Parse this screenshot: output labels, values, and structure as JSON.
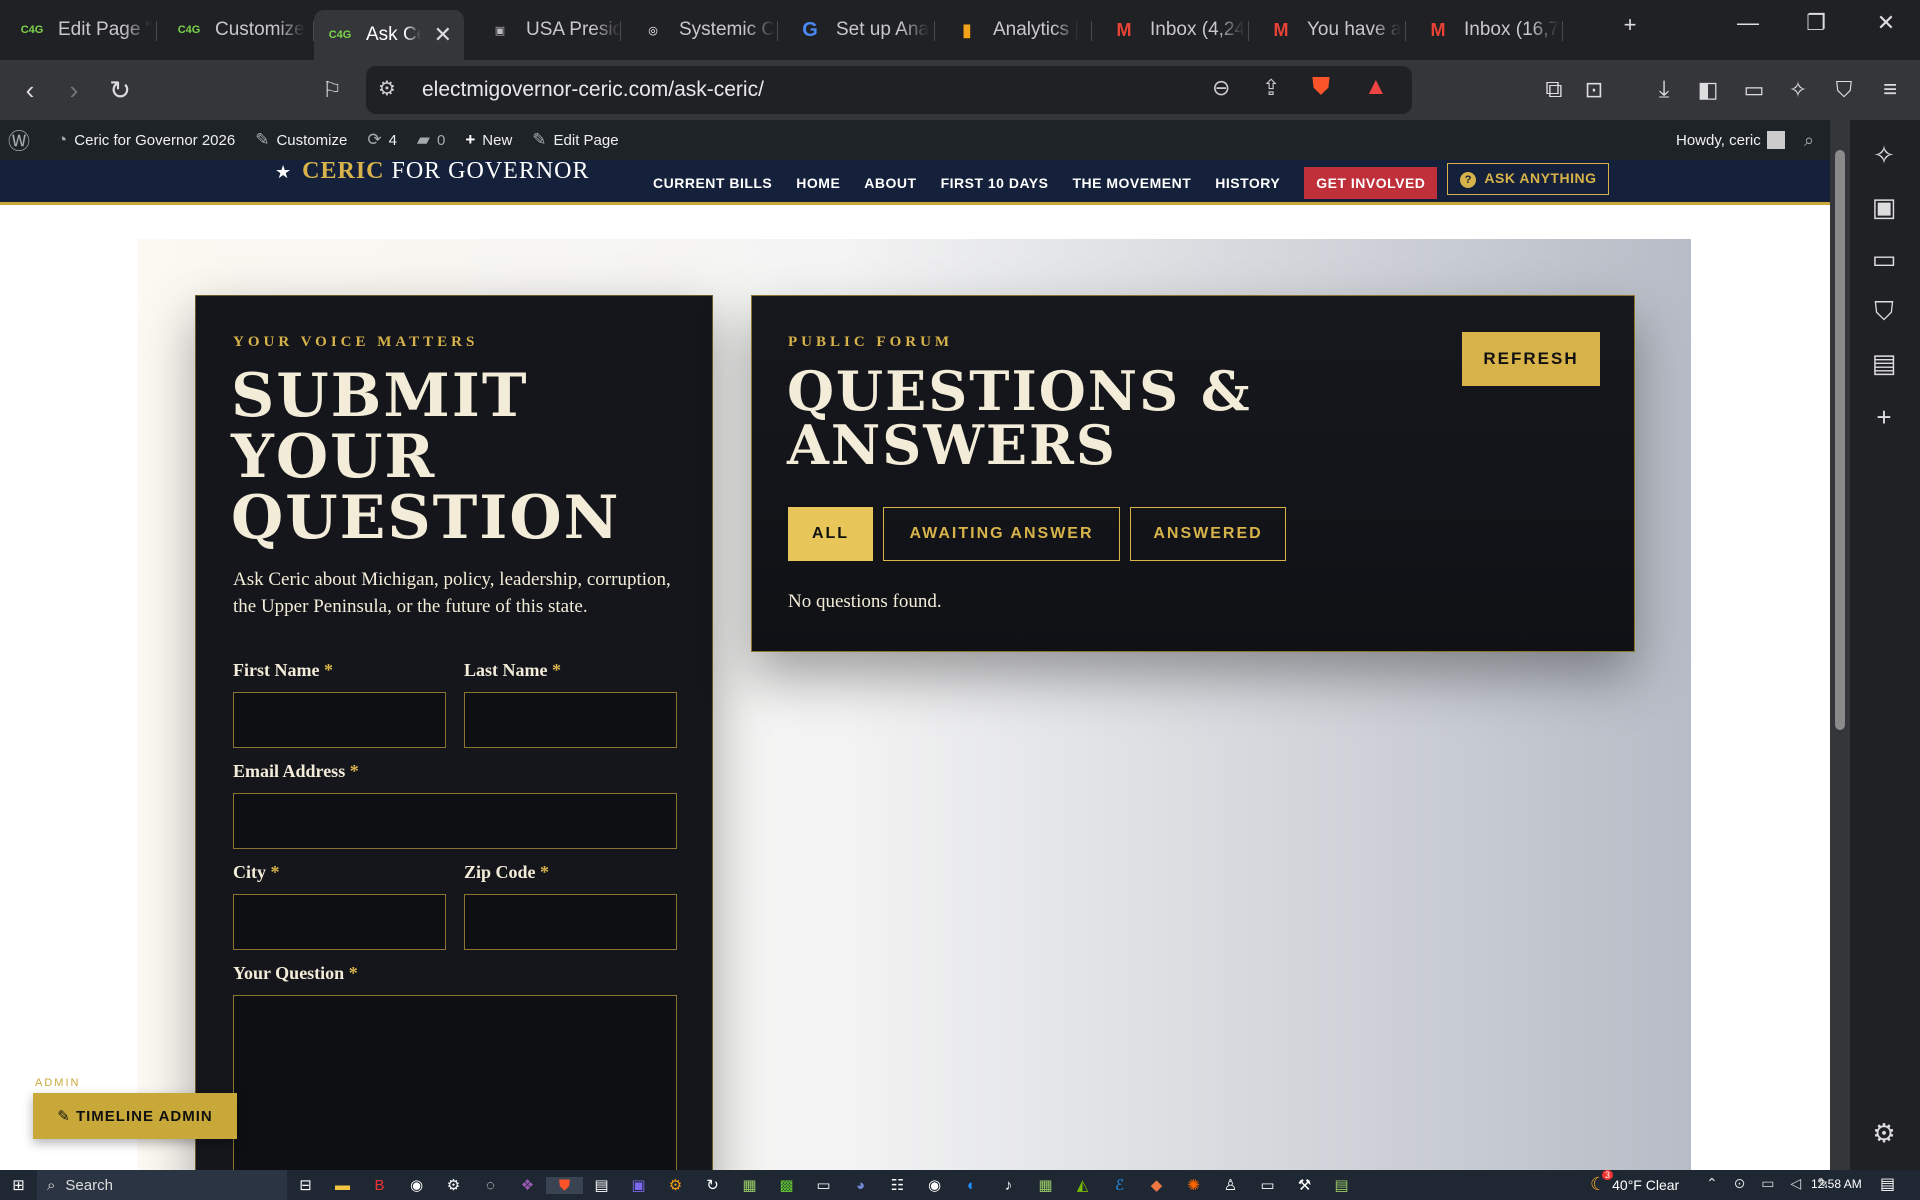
{
  "tabs": [
    {
      "title": "Edit Page \"",
      "icon": "C4G"
    },
    {
      "title": "Customize",
      "icon": "C4G"
    },
    {
      "title": "Ask Ce",
      "icon": "C4G",
      "active": true
    },
    {
      "title": "USA Presid",
      "icon": "▣"
    },
    {
      "title": "Systemic C",
      "icon": "◎"
    },
    {
      "title": "Set up Ana",
      "icon": "G"
    },
    {
      "title": "Analytics |",
      "icon": "▮"
    },
    {
      "title": "Inbox (4,24",
      "icon": "M"
    },
    {
      "title": "You have a",
      "icon": "M"
    },
    {
      "title": "Inbox (16,7",
      "icon": "M"
    }
  ],
  "address": {
    "url": "electmigovernor-ceric.com/ask-ceric/"
  },
  "wp": {
    "site": "Ceric for Governor 2026",
    "customize": "Customize",
    "updates": "4",
    "comments": "0",
    "new": "New",
    "edit": "Edit Page",
    "howdy": "Howdy, ceric"
  },
  "site": {
    "logo_bold": "CERIC",
    "logo_rest": " FOR GOVERNOR",
    "star": "★",
    "nav": [
      "CURRENT BILLS",
      "HOME",
      "ABOUT",
      "FIRST 10 DAYS",
      "THE MOVEMENT",
      "HISTORY"
    ],
    "get_involved": "GET INVOLVED",
    "ask_anything": "ASK ANYTHING"
  },
  "form": {
    "kicker": "YOUR VOICE MATTERS",
    "title_1": "SUBMIT",
    "title_2": "YOUR",
    "title_3": "QUESTION",
    "intro": "Ask Ceric about Michigan, policy, leadership, corruption, the Upper Peninsula, or the future of this state.",
    "first": "First Name",
    "last": "Last Name",
    "email": "Email Address",
    "city": "City",
    "zip": "Zip Code",
    "question": "Your Question",
    "req": "*"
  },
  "forum": {
    "kicker": "PUBLIC FORUM",
    "title_1": "QUESTIONS &",
    "title_2": "ANSWERS",
    "refresh": "REFRESH",
    "filters": [
      "ALL",
      "AWAITING ANSWER",
      "ANSWERED"
    ],
    "empty": "No questions found."
  },
  "admin": {
    "label": "ADMIN",
    "button": "✎ TIMELINE ADMIN"
  },
  "taskbar": {
    "search": "Search",
    "weather": "40°F  Clear",
    "time": "12:58 AM",
    "badge": "3"
  }
}
